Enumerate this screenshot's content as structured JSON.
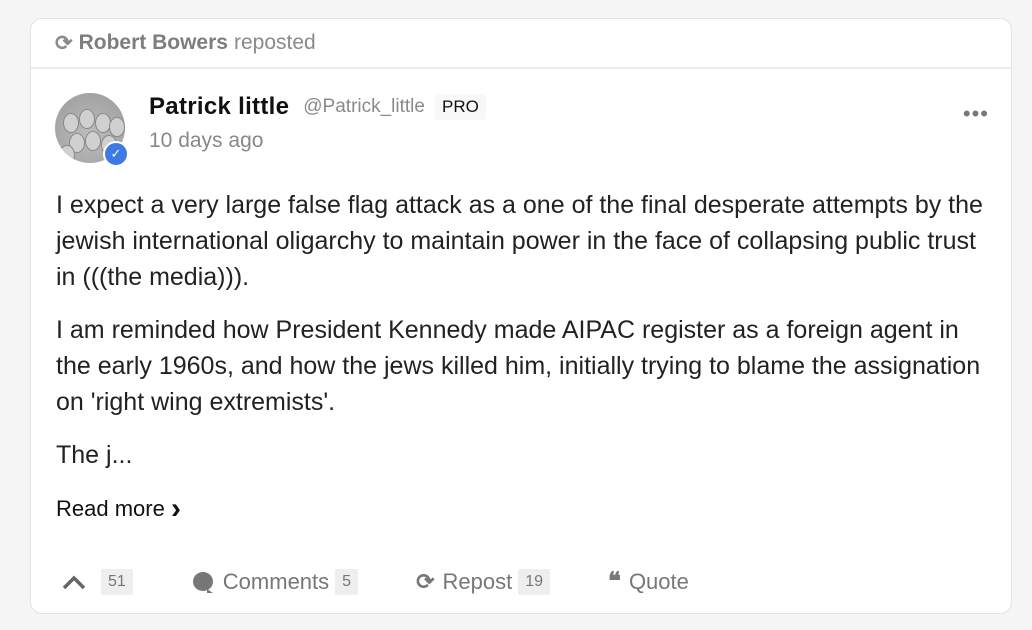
{
  "repost_header": {
    "icon": "repost-icon",
    "user": "Robert Bowers",
    "action": "reposted"
  },
  "post": {
    "author_name": "Patrick little",
    "author_handle": "@Patrick_little",
    "badge": "PRO",
    "time": "10 days ago",
    "more": "•••",
    "paragraphs": [
      "I expect a very large false flag attack as a one of the final desperate attempts by the jewish international oligarchy to maintain  power in the face of collapsing public trust in (((the media))).",
      "I am reminded how President Kennedy made AIPAC register as a foreign agent in the early 1960s, and how the jews killed him, initially trying to blame the assignation on 'right wing extremists'.",
      "The j..."
    ],
    "read_more": "Read more",
    "read_more_chevron": "›"
  },
  "actions": {
    "upvote_count": "51",
    "comments_label": "Comments",
    "comments_count": "5",
    "repost_label": "Repost",
    "repost_count": "19",
    "quote_label": "Quote",
    "upvote_glyph": "^",
    "repost_glyph": "⟳",
    "quote_glyph": "❝"
  },
  "colors": {
    "verified": "#3e7ae6",
    "muted": "#8a8a8a"
  }
}
